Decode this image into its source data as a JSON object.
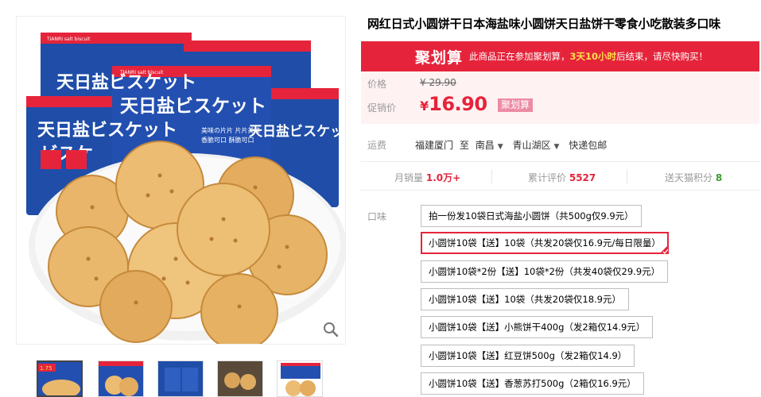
{
  "product": {
    "title": "网红日式小圆饼干日本海盐味小圆饼天日盐饼干零食小吃散装多口味"
  },
  "package_art": {
    "brand_text": "天日盐ビスケット",
    "katakana": "ビスケ",
    "strip_text": "TIANRI salt biscuit",
    "small_text_1": "美味の片片 片片美味",
    "small_text_2": "香脆可口 酥脆可口"
  },
  "promo_bar": {
    "logo": "聚划算",
    "notice_prefix": "此商品正在参加聚划算，",
    "notice_highlight": "3天10小时",
    "notice_suffix": "后结束，请尽快购买！"
  },
  "price": {
    "original_label": "价格",
    "original_value": "¥ 29.90",
    "promo_label": "促销价",
    "currency": "¥",
    "promo_value": "16.90",
    "promo_badge": "聚划算"
  },
  "shipping": {
    "label": "运费",
    "from": "福建厦门",
    "to_word": "至",
    "city": "南昌",
    "district": "青山湖区",
    "method": "快递包邮"
  },
  "stats": {
    "monthly_sales_label": "月销量",
    "monthly_sales_value": "1.0万+",
    "reviews_label": "累计评价",
    "reviews_value": "5527",
    "points_label": "送天猫积分",
    "points_value": "8"
  },
  "options": {
    "label": "口味",
    "items": [
      "拍一份发10袋日式海盐小圆饼（共500g仅9.9元）",
      "小圆饼10袋【送】10袋（共发20袋仅16.9元/每日限量）",
      "小圆饼10袋*2份【送】10袋*2份（共发40袋仅29.9元）",
      "小圆饼10袋【送】10袋（共发20袋仅18.9元）",
      "小圆饼10袋【送】小熊饼干400g（发2箱仅14.9元）",
      "小圆饼10袋【送】红豆饼500g（发2箱仅14.9）",
      "小圆饼10袋【送】香葱苏打500g（2箱仅16.9元）"
    ],
    "selected_index": 1
  },
  "thumbnails": {
    "active_index": 0,
    "badge_text": "1.75"
  },
  "icons": {
    "zoom": "magnifier-icon",
    "dropdown": "chevron-down-icon",
    "selected": "check-corner-icon"
  },
  "colors": {
    "accent_red": "#e5243b",
    "price_bg": "#fff2f3",
    "points_green": "#3a9a2f",
    "package_blue": "#1f4da8",
    "badge_pink": "#ec8ba4"
  }
}
